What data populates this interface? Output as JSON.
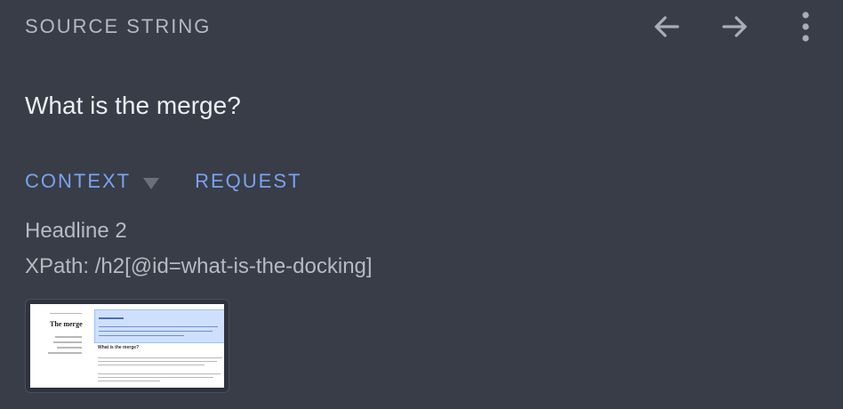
{
  "header": {
    "label": "SOURCE STRING",
    "icons": [
      "arrow-left-icon",
      "arrow-right-icon",
      "more-vertical-icon"
    ]
  },
  "source": {
    "text": "What is the merge?"
  },
  "tabs": {
    "context_label": "CONTEXT",
    "request_label": "REQUEST"
  },
  "context": {
    "type": "Headline 2",
    "xpath": "XPath: /h2[@id=what-is-the-docking]"
  },
  "thumbnail": {
    "title": "The merge",
    "highlight_text": "...",
    "section_heading": "What is the merge?"
  },
  "colors": {
    "background": "#383d48",
    "accent": "#7aa3f0",
    "muted_text": "#b7bac2"
  }
}
